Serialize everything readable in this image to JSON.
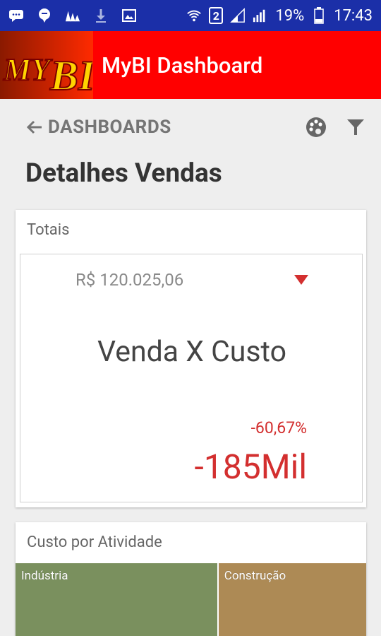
{
  "status_bar": {
    "battery": "19%",
    "time": "17:43",
    "sim_slot": "2",
    "left_icons": [
      "message-icon",
      "chat-icon",
      "app-icon",
      "download-icon",
      "image-icon"
    ],
    "right_icons": [
      "wifi-icon",
      "sim-icon",
      "signal-icon",
      "signal-icon",
      "battery-icon"
    ]
  },
  "app": {
    "logo_text": "MY BI",
    "title": "MyBI Dashboard",
    "accent": "#ff0000"
  },
  "nav": {
    "back_label": "DASHBOARDS",
    "icons": [
      "palette-icon",
      "filter-icon"
    ]
  },
  "page": {
    "title": "Detalhes Vendas"
  },
  "totals_card": {
    "title": "Totais",
    "reference_value": "R$ 120.025,06",
    "trend": "down",
    "trend_color": "#d32f2f",
    "kpi_name": "Venda X Custo",
    "percent": "-60,67%",
    "value": "-185Mil"
  },
  "activity_card": {
    "title": "Custo por Atividade",
    "tiles": [
      {
        "label": "Indústria",
        "color": "#7a905e",
        "share": 0.575
      },
      {
        "label": "Construção",
        "color": "#ad8a55",
        "share": 0.425
      }
    ]
  }
}
